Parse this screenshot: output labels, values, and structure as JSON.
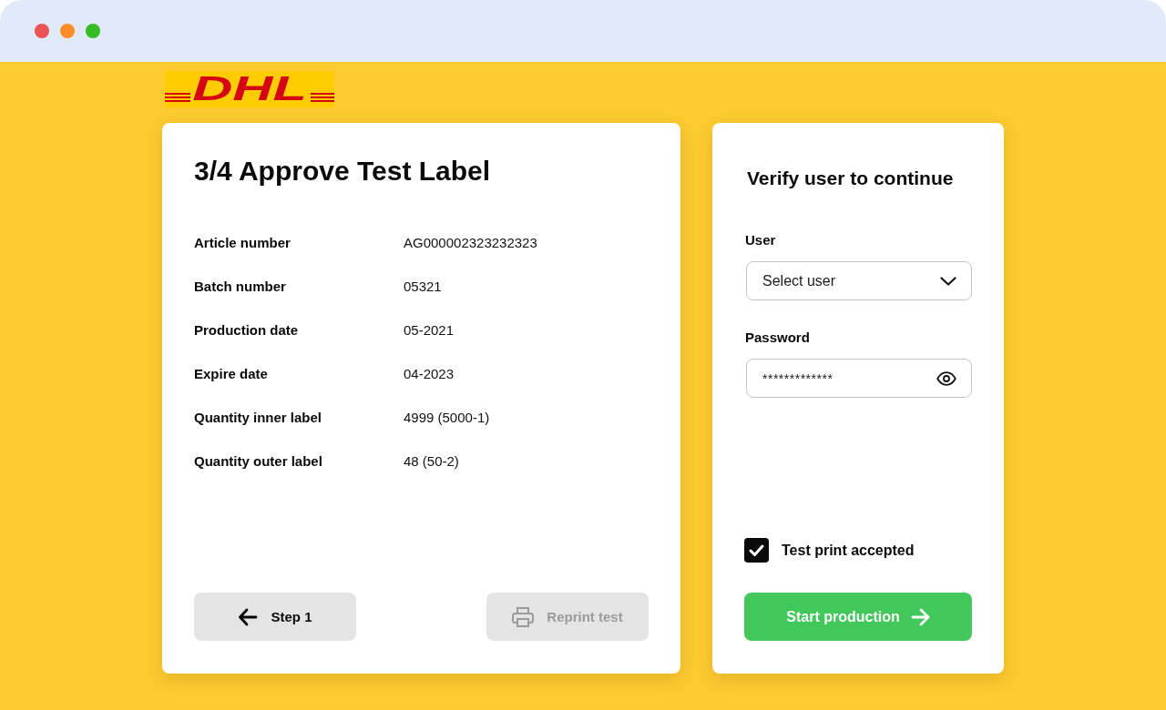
{
  "window": {
    "traffic_lights": [
      {
        "color": "#ed5255"
      },
      {
        "color": "#fd8c27"
      },
      {
        "color": "#36bd26"
      }
    ]
  },
  "logo": {
    "text": "DHL"
  },
  "label_card": {
    "title": "3/4 Approve Test Label",
    "fields": [
      {
        "label": "Article number",
        "value": "AG000002323232323"
      },
      {
        "label": "Batch number",
        "value": "05321"
      },
      {
        "label": "Production date",
        "value": "05-2021"
      },
      {
        "label": "Expire date",
        "value": "04-2023"
      },
      {
        "label": "Quantity inner label",
        "value": "4999 (5000-1)"
      },
      {
        "label": "Quantity outer label",
        "value": "48 (50-2)"
      }
    ],
    "buttons": [
      {
        "kind": "back",
        "label": "Step 1",
        "disabled": false
      },
      {
        "kind": "reprint",
        "label": "Reprint test",
        "disabled": true
      }
    ]
  },
  "verify_card": {
    "title": "Verify user to continue",
    "user": {
      "label": "User",
      "value": "Select user"
    },
    "password": {
      "label": "Password",
      "value": "*************"
    },
    "accept": {
      "label": "Test print accepted",
      "checked": true
    },
    "submit": {
      "label": "Start production"
    }
  }
}
